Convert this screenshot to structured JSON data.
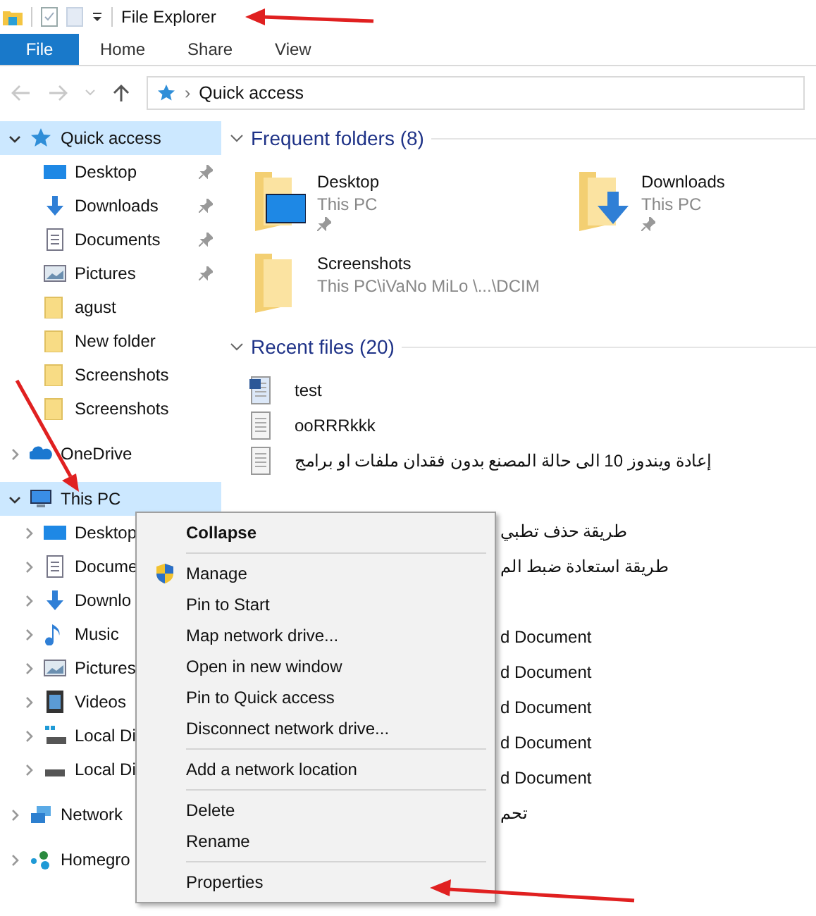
{
  "window": {
    "title": "File Explorer"
  },
  "ribbon_tabs": [
    {
      "label": "File",
      "kind": "file",
      "selected": false
    },
    {
      "label": "Home",
      "kind": "tab",
      "selected": false
    },
    {
      "label": "Share",
      "kind": "tab",
      "selected": false
    },
    {
      "label": "View",
      "kind": "tab",
      "selected": false
    }
  ],
  "address_bar": {
    "path": "Quick access",
    "separator": "›"
  },
  "sidebar": {
    "items": [
      {
        "label": "Quick access",
        "kind": "star",
        "expanded": true,
        "selected": true,
        "children": [
          {
            "label": "Desktop",
            "kind": "desktop",
            "pinned": true
          },
          {
            "label": "Downloads",
            "kind": "download",
            "pinned": true
          },
          {
            "label": "Documents",
            "kind": "documents",
            "pinned": true
          },
          {
            "label": "Pictures",
            "kind": "pictures",
            "pinned": true
          },
          {
            "label": "agust",
            "kind": "folder",
            "pinned": false
          },
          {
            "label": "New folder",
            "kind": "folder",
            "pinned": false
          },
          {
            "label": "Screenshots",
            "kind": "folder",
            "pinned": false
          },
          {
            "label": "Screenshots",
            "kind": "folder",
            "pinned": false
          }
        ]
      },
      {
        "label": "OneDrive",
        "kind": "cloud",
        "expanded": false,
        "selected": false
      },
      {
        "label": "This PC",
        "kind": "pc",
        "expanded": true,
        "selected": true,
        "children": [
          {
            "label": "Desktop",
            "kind": "desktop",
            "expanded": false
          },
          {
            "label": "Docume",
            "kind": "documents",
            "expanded": false
          },
          {
            "label": "Downlo",
            "kind": "download",
            "expanded": false
          },
          {
            "label": "Music",
            "kind": "music",
            "expanded": false
          },
          {
            "label": "Pictures",
            "kind": "pictures",
            "expanded": false
          },
          {
            "label": "Videos",
            "kind": "videos",
            "expanded": false
          },
          {
            "label": "Local Di",
            "kind": "drive-win",
            "expanded": false
          },
          {
            "label": "Local Di",
            "kind": "drive",
            "expanded": false
          }
        ]
      },
      {
        "label": "Network",
        "kind": "network",
        "expanded": false,
        "selected": false
      },
      {
        "label": "Homegro",
        "kind": "homegroup",
        "expanded": false,
        "selected": false
      }
    ]
  },
  "frequent_folders": {
    "heading": "Frequent folders (8)",
    "folders": [
      {
        "name": "Desktop",
        "location": "This PC",
        "kind": "desktop",
        "pinned": true
      },
      {
        "name": "Downloads",
        "location": "This PC",
        "kind": "download",
        "pinned": true
      },
      {
        "name": "Screenshots",
        "location": "This PC\\iVaNo MiLo \\...\\DCIM",
        "kind": "folder",
        "pinned": false
      }
    ]
  },
  "recent_files": {
    "heading": "Recent files (20)",
    "files": [
      {
        "name": "test",
        "kind": "word"
      },
      {
        "name": "ooRRRkkk",
        "kind": "text"
      },
      {
        "name": "إعادة ويندوز 10 الى حالة المصنع بدون فقدان ملفات او برامج",
        "kind": "text"
      },
      {
        "kind": "hidden"
      },
      {
        "name": "طريقة حذف تطبي",
        "kind": "covered"
      },
      {
        "name": "طريقة استعادة ضبط الم",
        "kind": "covered"
      },
      {
        "kind": "hidden"
      },
      {
        "name": "d Document",
        "kind": "covered"
      },
      {
        "name": "d Document",
        "kind": "covered"
      },
      {
        "name": "d Document",
        "kind": "covered"
      },
      {
        "name": "d Document",
        "kind": "covered"
      },
      {
        "name": "d Document",
        "kind": "covered"
      },
      {
        "name": "تحم",
        "kind": "covered"
      }
    ]
  },
  "context_menu": {
    "groups": [
      [
        {
          "label": "Collapse",
          "kind": "default"
        }
      ],
      [
        {
          "label": "Manage",
          "kind": "admin"
        },
        {
          "label": "Pin to Start",
          "kind": "normal"
        },
        {
          "label": "Map network drive...",
          "kind": "normal"
        },
        {
          "label": "Open in new window",
          "kind": "normal"
        },
        {
          "label": "Pin to Quick access",
          "kind": "normal"
        },
        {
          "label": "Disconnect network drive...",
          "kind": "normal"
        }
      ],
      [
        {
          "label": "Add a network location",
          "kind": "normal"
        }
      ],
      [
        {
          "label": "Delete",
          "kind": "normal"
        },
        {
          "label": "Rename",
          "kind": "normal"
        }
      ],
      [
        {
          "label": "Properties",
          "kind": "normal"
        }
      ]
    ]
  }
}
